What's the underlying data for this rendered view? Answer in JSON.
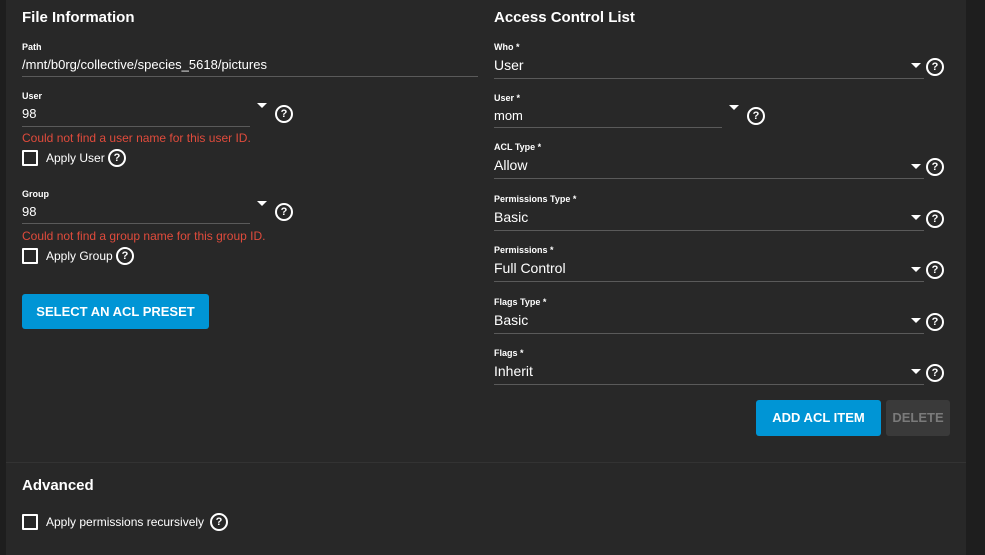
{
  "file_info": {
    "title": "File Information",
    "path_label": "Path",
    "path_value": "/mnt/b0rg/collective/species_5618/pictures",
    "user_label": "User",
    "user_value": "98",
    "user_error": "Could not find a user name for this user ID.",
    "apply_user_label": "Apply User",
    "group_label": "Group",
    "group_value": "98",
    "group_error": "Could not find a group name for this group ID.",
    "apply_group_label": "Apply Group",
    "preset_button": "SELECT AN ACL PRESET"
  },
  "acl": {
    "title": "Access Control List",
    "who_label": "Who *",
    "who_value": "User",
    "user_label": "User *",
    "user_value": "mom",
    "acl_type_label": "ACL Type *",
    "acl_type_value": "Allow",
    "perm_type_label": "Permissions Type *",
    "perm_type_value": "Basic",
    "perms_label": "Permissions *",
    "perms_value": "Full Control",
    "flags_type_label": "Flags Type *",
    "flags_type_value": "Basic",
    "flags_label": "Flags *",
    "flags_value": "Inherit",
    "add_button": "ADD ACL ITEM",
    "delete_button": "DELETE"
  },
  "advanced": {
    "title": "Advanced",
    "recursive_label": "Apply permissions recursively"
  },
  "icons": {
    "help": "?"
  },
  "colors": {
    "accent": "#0095d5",
    "error": "#e04b3c",
    "panel": "#282828"
  }
}
